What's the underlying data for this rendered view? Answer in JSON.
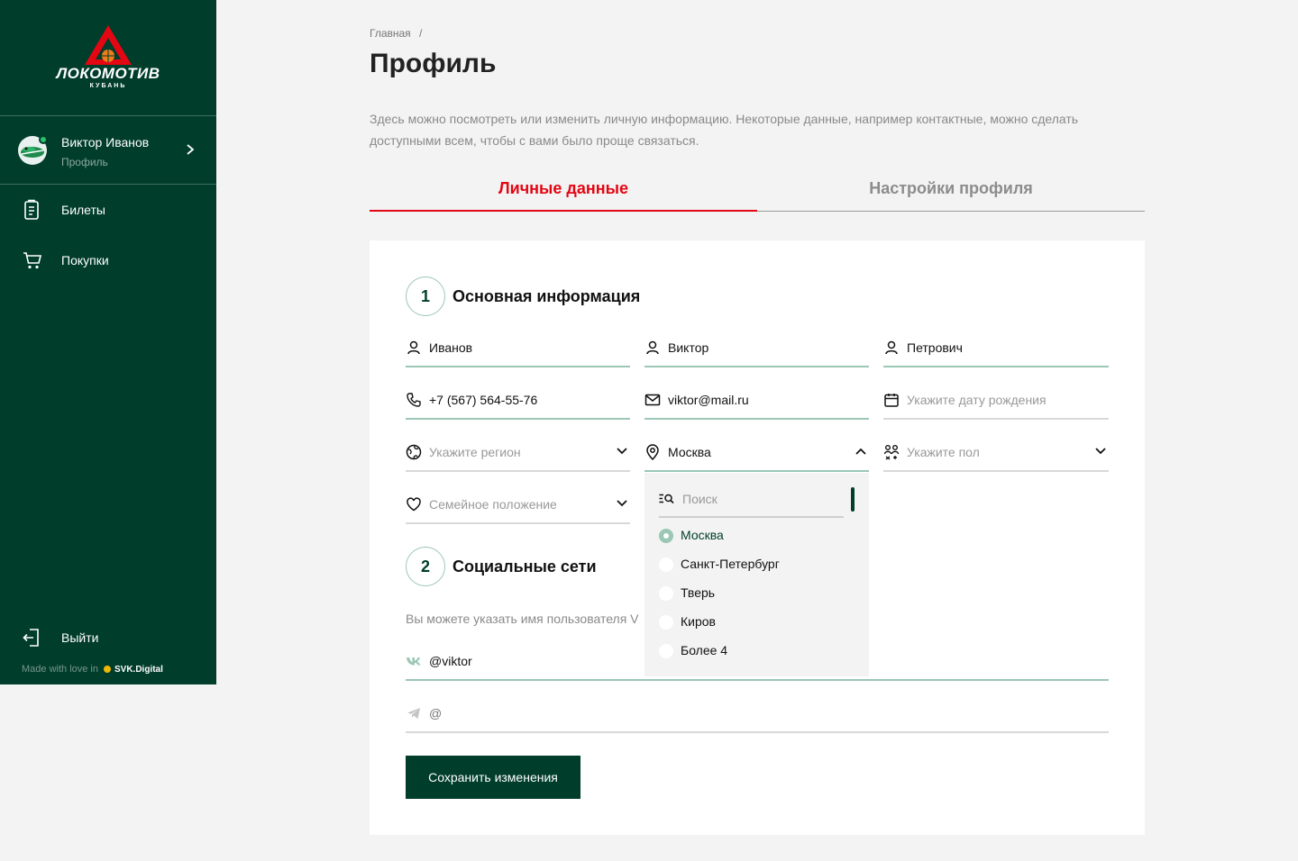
{
  "sidebar": {
    "logo_text": "ЛОКОМОТИВ",
    "logo_sub": "КУБАНЬ",
    "user": {
      "name": "Виктор Иванов",
      "subtitle": "Профиль"
    },
    "items": [
      {
        "label": "Билеты",
        "icon": "ticket-icon"
      },
      {
        "label": "Покупки",
        "icon": "cart-icon"
      }
    ],
    "logout_label": "Выйти",
    "footer": {
      "made_with": "Made with love in",
      "brand": "SVK.Digital"
    }
  },
  "breadcrumb": {
    "home": "Главная",
    "separator": "/"
  },
  "page_title": "Профиль",
  "description": "Здесь можно посмотреть или изменить личную информацию. Некоторые данные, например контактные, можно сделать доступными всем, чтобы с вами было проще связаться.",
  "tabs": [
    {
      "label": "Личные данные",
      "active": true
    },
    {
      "label": "Настройки профиля",
      "active": false
    }
  ],
  "section1": {
    "number": "1",
    "title": "Основная информация"
  },
  "fields": {
    "last_name": "Иванов",
    "first_name": "Виктор",
    "middle_name": "Петрович",
    "phone": "+7 (567) 564-55-76",
    "email": "viktor@mail.ru",
    "birthday_placeholder": "Укажите дату рождения",
    "region_placeholder": "Укажите регион",
    "city": "Москва",
    "gender_placeholder": "Укажите пол",
    "marital_placeholder": "Семейное положение"
  },
  "city_dropdown": {
    "search_placeholder": "Поиск",
    "options": [
      {
        "label": "Москва",
        "selected": true
      },
      {
        "label": "Санкт-Петербург",
        "selected": false
      },
      {
        "label": "Тверь",
        "selected": false
      },
      {
        "label": "Киров",
        "selected": false
      },
      {
        "label": "Более 4",
        "selected": false
      }
    ]
  },
  "section2": {
    "number": "2",
    "title": "Социальные сети"
  },
  "social_hint": "Вы можете указать имя пользователя V",
  "social": {
    "vk_value": "@viktor",
    "telegram_value": "@"
  },
  "save_label": "Сохранить изменения",
  "colors": {
    "sidebar": "#003d2b",
    "accent": "#e30613",
    "field_line": "#9bc7b5",
    "button": "#003d2b"
  }
}
